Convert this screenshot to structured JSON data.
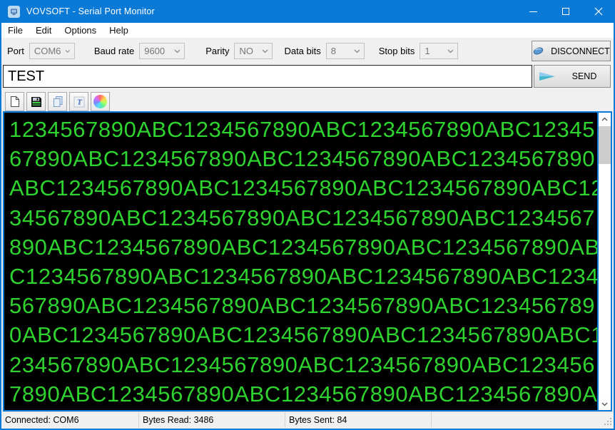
{
  "window": {
    "title": "VOVSOFT - Serial Port Monitor"
  },
  "menu": {
    "items": [
      "File",
      "Edit",
      "Options",
      "Help"
    ]
  },
  "config": {
    "fields": [
      {
        "label": "Port",
        "value": "COM6"
      },
      {
        "label": "Baud rate",
        "value": "9600"
      },
      {
        "label": "Parity",
        "value": "NO"
      },
      {
        "label": "Data bits",
        "value": "8"
      },
      {
        "label": "Stop bits",
        "value": "1"
      }
    ],
    "disconnect_label": "DISCONNECT"
  },
  "send": {
    "input_value": "TEST",
    "button_label": "SEND"
  },
  "toolbar": {
    "icons": [
      "new-document-icon",
      "save-icon",
      "copy-icon",
      "font-icon",
      "colors-icon"
    ]
  },
  "terminal": {
    "lines": [
      "1234567890ABC1234567890ABC1234567890ABC12345",
      "67890ABC1234567890ABC1234567890ABC1234567890",
      "ABC1234567890ABC1234567890ABC1234567890ABC12",
      "34567890ABC1234567890ABC1234567890ABC1234567",
      "890ABC1234567890ABC1234567890ABC1234567890AB",
      "C1234567890ABC1234567890ABC1234567890ABC1234",
      "567890ABC1234567890ABC1234567890ABC123456789",
      "0ABC1234567890ABC1234567890ABC1234567890ABC1",
      "234567890ABC1234567890ABC1234567890ABC123456",
      "7890ABC1234567890ABC1234567890ABC1234567890A"
    ],
    "text_color": "#2fd32f",
    "background": "#000000"
  },
  "status": {
    "panels": [
      "Connected: COM6",
      "Bytes Read: 3486",
      "Bytes Sent: 84"
    ]
  },
  "colors": {
    "titlebar": "#0a7ad6",
    "accent_border": "#0a7ad6"
  }
}
